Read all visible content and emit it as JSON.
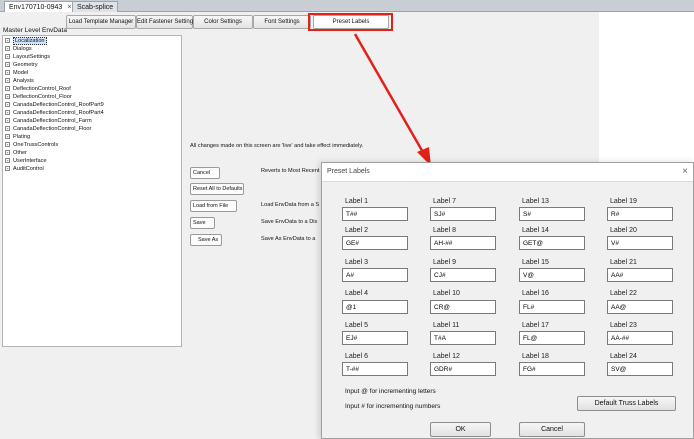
{
  "doc_tabs": [
    {
      "label": "Env170710-0943",
      "close": "×"
    },
    {
      "label": "Scab-splice"
    }
  ],
  "settings_buttons": [
    "Load Template Manager",
    "Edit Fastener Settings",
    "Color Settings",
    "Font Settings",
    "Preset Labels"
  ],
  "master_label": "Master Level EnvData",
  "tree_items": [
    "Localization",
    "Dialogs",
    "LayoutSettings",
    "Geometry",
    "Model",
    "Analysis",
    "DeflectionControl_Roof",
    "DeflectionControl_Floor",
    "CanadaDeflectionControl_RoofPart9",
    "CanadaDeflectionControl_RoofPart4",
    "CanadaDeflectionControl_Farm",
    "CanadaDeflectionControl_Floor",
    "Plating",
    "OneTrussControls",
    "Other",
    "UserInterface",
    "AuditControl"
  ],
  "tree_plus": "+",
  "live_note": "All changes made on this screen are 'live' and take effect immediately.",
  "actions": [
    {
      "button": "Cancel",
      "desc": "Reverts to Most Recent"
    },
    {
      "button": "Reset All to Defaults",
      "desc": ""
    },
    {
      "button": "Load from File",
      "desc": "Load EnvData from a S"
    },
    {
      "button": "Save",
      "desc": "Save EnvData to a Dis"
    },
    {
      "button": "Save As",
      "desc": "Save As EnvData to a"
    }
  ],
  "dialog": {
    "title": "Preset Labels",
    "close": "×",
    "labels": [
      {
        "caption": "Label 1",
        "value": "T##"
      },
      {
        "caption": "Label 2",
        "value": "GE#"
      },
      {
        "caption": "Label 3",
        "value": "A#"
      },
      {
        "caption": "Label 4",
        "value": "@1"
      },
      {
        "caption": "Label 5",
        "value": "EJ#"
      },
      {
        "caption": "Label 6",
        "value": "T-##"
      },
      {
        "caption": "Label 7",
        "value": "SJ#"
      },
      {
        "caption": "Label 8",
        "value": "AH-##"
      },
      {
        "caption": "Label 9",
        "value": "CJ#"
      },
      {
        "caption": "Label 10",
        "value": "CR@"
      },
      {
        "caption": "Label 11",
        "value": "T#A"
      },
      {
        "caption": "Label 12",
        "value": "GDR#"
      },
      {
        "caption": "Label 13",
        "value": "S#"
      },
      {
        "caption": "Label 14",
        "value": "GET@"
      },
      {
        "caption": "Label 15",
        "value": "V@"
      },
      {
        "caption": "Label 16",
        "value": "FL#"
      },
      {
        "caption": "Label 17",
        "value": "FL@"
      },
      {
        "caption": "Label 18",
        "value": "FG#"
      },
      {
        "caption": "Label 19",
        "value": "R#"
      },
      {
        "caption": "Label 20",
        "value": "V#"
      },
      {
        "caption": "Label 21",
        "value": "AA#"
      },
      {
        "caption": "Label 22",
        "value": "AA@"
      },
      {
        "caption": "Label 23",
        "value": "AA-##"
      },
      {
        "caption": "Label 24",
        "value": "SV@"
      }
    ],
    "hint_letters": "Input @ for incrementing letters",
    "hint_numbers": "Input # for incrementing numbers",
    "default_button": "Default Truss Labels",
    "ok": "OK",
    "cancel": "Cancel"
  },
  "colors": {
    "annotation": "#e32119",
    "selection": "#cfe3ff"
  }
}
